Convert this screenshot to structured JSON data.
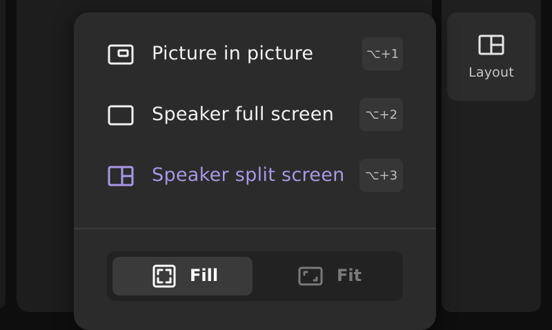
{
  "colors": {
    "accent": "#a998e6",
    "text": "#f2f2f2",
    "muted": "#7a7a7a"
  },
  "layout_button": {
    "label": "Layout",
    "icon": "layout-split-icon"
  },
  "menu": {
    "items": [
      {
        "label": "Picture in picture",
        "shortcut": "⌥+1",
        "icon": "picture-in-picture-icon",
        "selected": false
      },
      {
        "label": "Speaker full screen",
        "shortcut": "⌥+2",
        "icon": "full-screen-icon",
        "selected": false
      },
      {
        "label": "Speaker split screen",
        "shortcut": "⌥+3",
        "icon": "split-screen-icon",
        "selected": true
      }
    ]
  },
  "scale": {
    "options": [
      {
        "label": "Fill",
        "icon": "fill-icon",
        "selected": true
      },
      {
        "label": "Fit",
        "icon": "fit-icon",
        "selected": false
      }
    ]
  }
}
